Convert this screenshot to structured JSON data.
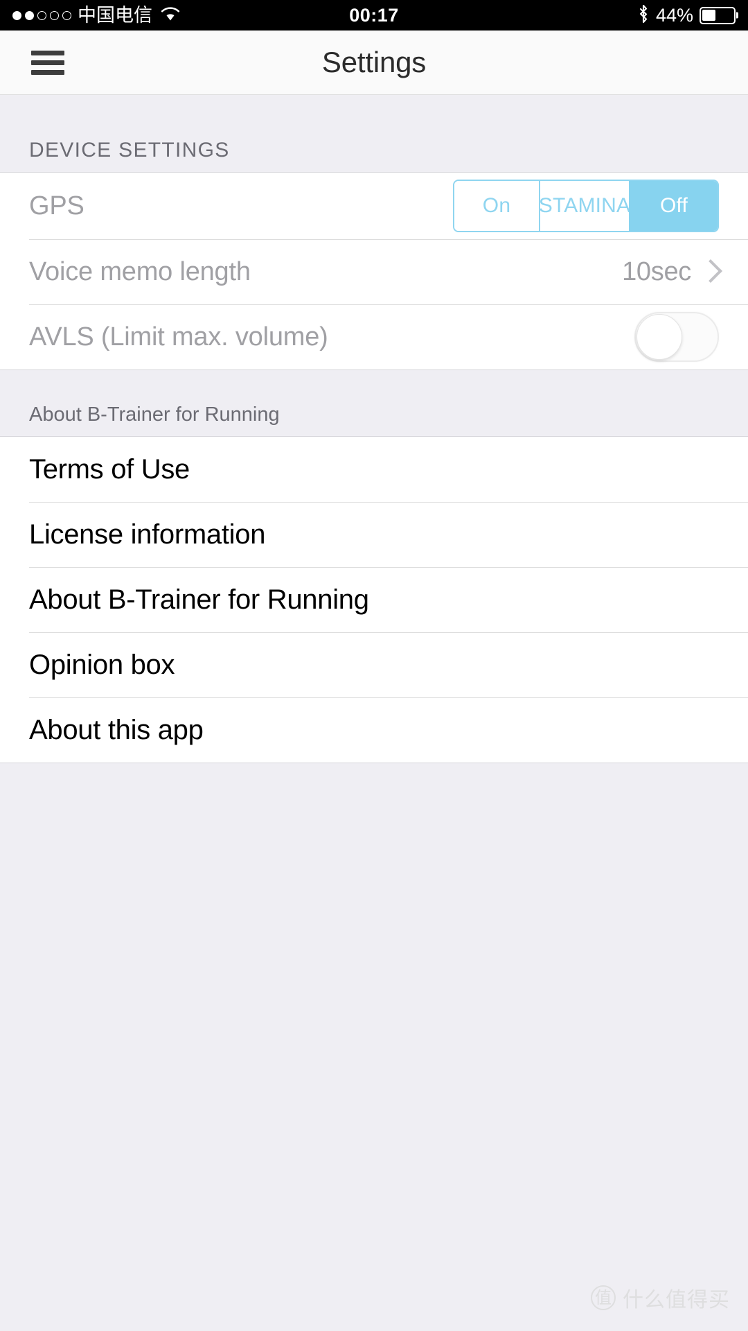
{
  "status_bar": {
    "signal_dots_total": 5,
    "signal_dots_filled": 2,
    "carrier": "中国电信",
    "wifi_icon": "wifi-icon",
    "time": "00:17",
    "bluetooth_icon": "bluetooth-icon",
    "battery_percent": "44%",
    "battery_level": 44
  },
  "nav": {
    "menu_icon": "hamburger-menu-icon",
    "title": "Settings"
  },
  "sections": {
    "device": {
      "header": "DEVICE SETTINGS",
      "gps": {
        "label": "GPS",
        "options": [
          "On",
          "STAMINA",
          "Off"
        ],
        "selected": "Off"
      },
      "voice_memo": {
        "label": "Voice memo length",
        "value": "10sec",
        "chevron_icon": "chevron-right-icon"
      },
      "avls": {
        "label": "AVLS (Limit max. volume)",
        "toggle_state": "off"
      }
    },
    "about": {
      "header": "About B-Trainer for Running",
      "items": [
        {
          "label": "Terms of Use"
        },
        {
          "label": "License information"
        },
        {
          "label": "About B-Trainer for Running"
        },
        {
          "label": "Opinion box"
        },
        {
          "label": "About this app"
        }
      ]
    }
  },
  "watermark": {
    "logo_glyph": "值",
    "text": "什么值得买"
  },
  "colors": {
    "accent": "#87d3ef",
    "accent_border": "#8fd5f0",
    "page_bg": "#efeef3",
    "row_bg": "#ffffff",
    "disabled_text": "#a0a0a4",
    "header_text": "#6b6b73",
    "primary_text": "#000000"
  }
}
